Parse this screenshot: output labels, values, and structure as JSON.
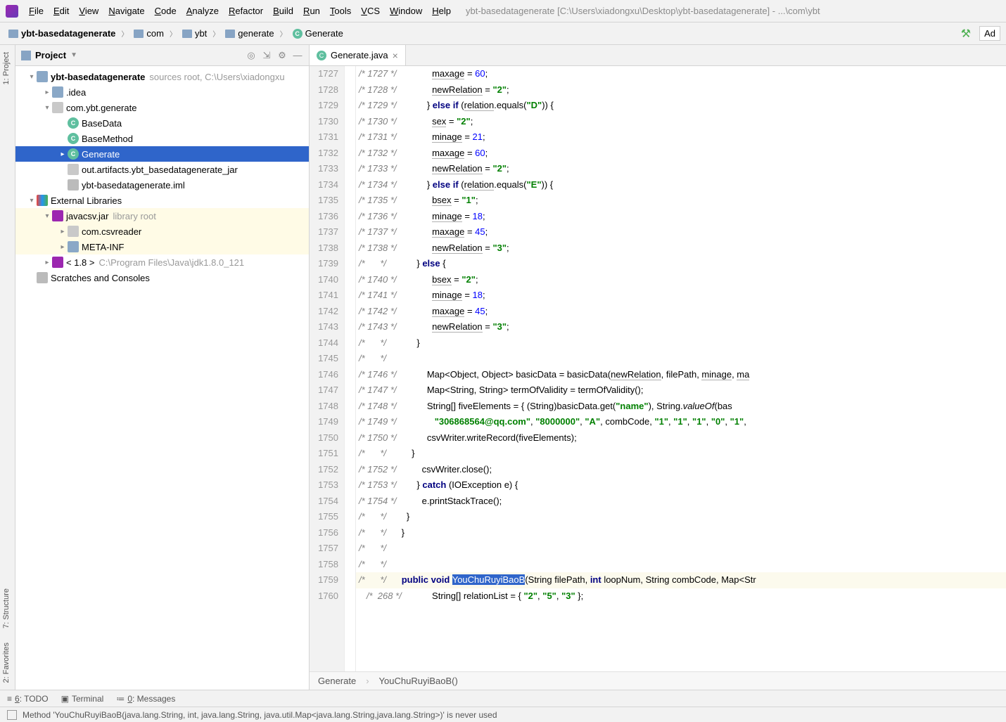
{
  "window": {
    "title_path": "ybt-basedatagenerate [C:\\Users\\xiadongxu\\Desktop\\ybt-basedatagenerate] - ...\\com\\ybt"
  },
  "menubar": {
    "items": [
      "File",
      "Edit",
      "View",
      "Navigate",
      "Code",
      "Analyze",
      "Refactor",
      "Build",
      "Run",
      "Tools",
      "VCS",
      "Window",
      "Help"
    ]
  },
  "navbar": {
    "crumbs": [
      {
        "icon": "folder",
        "label": "ybt-basedatagenerate",
        "bold": true
      },
      {
        "icon": "folder",
        "label": "com"
      },
      {
        "icon": "folder",
        "label": "ybt"
      },
      {
        "icon": "folder",
        "label": "generate"
      },
      {
        "icon": "class",
        "label": "Generate"
      }
    ],
    "right_button": "Ad"
  },
  "project": {
    "title": "Project",
    "tools": [
      "target-icon",
      "collapse-icon",
      "gear-icon",
      "hide-icon"
    ],
    "tree": [
      {
        "depth": 0,
        "chev": "down",
        "icon": "folder",
        "label": "ybt-basedatagenerate",
        "aux": "sources root,  C:\\Users\\xiadongxu"
      },
      {
        "depth": 1,
        "chev": "right",
        "icon": "folder",
        "label": ".idea"
      },
      {
        "depth": 1,
        "chev": "down",
        "icon": "pkg",
        "label": "com.ybt.generate"
      },
      {
        "depth": 2,
        "chev": "",
        "icon": "class",
        "label": "BaseData"
      },
      {
        "depth": 2,
        "chev": "",
        "icon": "class",
        "label": "BaseMethod"
      },
      {
        "depth": 2,
        "chev": "right",
        "icon": "class",
        "label": "Generate",
        "selected": true
      },
      {
        "depth": 2,
        "chev": "",
        "icon": "pkg",
        "label": "out.artifacts.ybt_basedatagenerate_jar"
      },
      {
        "depth": 2,
        "chev": "",
        "icon": "file",
        "label": "ybt-basedatagenerate.iml"
      },
      {
        "depth": 0,
        "chev": "down",
        "icon": "lib",
        "label": "External Libraries"
      },
      {
        "depth": 1,
        "chev": "down",
        "icon": "jar",
        "label": "javacsv.jar",
        "aux": "library root",
        "libbg": true
      },
      {
        "depth": 2,
        "chev": "right",
        "icon": "pkg",
        "label": "com.csvreader",
        "libbg": true
      },
      {
        "depth": 2,
        "chev": "right",
        "icon": "folder",
        "label": "META-INF",
        "libbg": true
      },
      {
        "depth": 1,
        "chev": "right",
        "icon": "jar",
        "label": "< 1.8 >",
        "aux": "C:\\Program Files\\Java\\jdk1.8.0_121"
      },
      {
        "depth": 0,
        "chev": "",
        "icon": "file",
        "label": "Scratches and Consoles"
      }
    ]
  },
  "left_strip": {
    "tabs": [
      "1: Project",
      "7: Structure",
      "2: Favorites"
    ]
  },
  "editor": {
    "tab": {
      "label": "Generate.java"
    },
    "breadcrumbs": [
      "Generate",
      "YouChuRuyiBaoB()"
    ],
    "lines": [
      {
        "n": 1727,
        "cm": "/* 1727 */",
        "parts": [
          {
            "t": "id-u",
            "v": "maxage"
          },
          {
            "t": "",
            "v": " = "
          },
          {
            "t": "num",
            "v": "60"
          },
          {
            "t": "",
            "v": ";"
          }
        ],
        "ind": 10
      },
      {
        "n": 1728,
        "cm": "/* 1728 */",
        "parts": [
          {
            "t": "id-u",
            "v": "newRelation"
          },
          {
            "t": "",
            "v": " = "
          },
          {
            "t": "str",
            "v": "\"2\""
          },
          {
            "t": "",
            "v": ";"
          }
        ],
        "ind": 10
      },
      {
        "n": 1729,
        "cm": "/* 1729 */",
        "parts": [
          {
            "t": "",
            "v": "} "
          },
          {
            "t": "kw",
            "v": "else if"
          },
          {
            "t": "",
            "v": " ("
          },
          {
            "t": "id-u",
            "v": "relation"
          },
          {
            "t": "",
            "v": ".equals("
          },
          {
            "t": "str",
            "v": "\"D\""
          },
          {
            "t": "",
            "v": ")) {"
          }
        ],
        "ind": 8
      },
      {
        "n": 1730,
        "cm": "/* 1730 */",
        "parts": [
          {
            "t": "id-u",
            "v": "sex"
          },
          {
            "t": "",
            "v": " = "
          },
          {
            "t": "str",
            "v": "\"2\""
          },
          {
            "t": "",
            "v": ";"
          }
        ],
        "ind": 10
      },
      {
        "n": 1731,
        "cm": "/* 1731 */",
        "parts": [
          {
            "t": "id-u",
            "v": "minage"
          },
          {
            "t": "",
            "v": " = "
          },
          {
            "t": "num",
            "v": "21"
          },
          {
            "t": "",
            "v": ";"
          }
        ],
        "ind": 10
      },
      {
        "n": 1732,
        "cm": "/* 1732 */",
        "parts": [
          {
            "t": "id-u",
            "v": "maxage"
          },
          {
            "t": "",
            "v": " = "
          },
          {
            "t": "num",
            "v": "60"
          },
          {
            "t": "",
            "v": ";"
          }
        ],
        "ind": 10
      },
      {
        "n": 1733,
        "cm": "/* 1733 */",
        "parts": [
          {
            "t": "id-u",
            "v": "newRelation"
          },
          {
            "t": "",
            "v": " = "
          },
          {
            "t": "str",
            "v": "\"2\""
          },
          {
            "t": "",
            "v": ";"
          }
        ],
        "ind": 10
      },
      {
        "n": 1734,
        "cm": "/* 1734 */",
        "parts": [
          {
            "t": "",
            "v": "} "
          },
          {
            "t": "kw",
            "v": "else if"
          },
          {
            "t": "",
            "v": " ("
          },
          {
            "t": "id-u",
            "v": "relation"
          },
          {
            "t": "",
            "v": ".equals("
          },
          {
            "t": "str",
            "v": "\"E\""
          },
          {
            "t": "",
            "v": ")) {"
          }
        ],
        "ind": 8
      },
      {
        "n": 1735,
        "cm": "/* 1735 */",
        "parts": [
          {
            "t": "id-u",
            "v": "bsex"
          },
          {
            "t": "",
            "v": " = "
          },
          {
            "t": "str",
            "v": "\"1\""
          },
          {
            "t": "",
            "v": ";"
          }
        ],
        "ind": 10
      },
      {
        "n": 1736,
        "cm": "/* 1736 */",
        "parts": [
          {
            "t": "id-u",
            "v": "minage"
          },
          {
            "t": "",
            "v": " = "
          },
          {
            "t": "num",
            "v": "18"
          },
          {
            "t": "",
            "v": ";"
          }
        ],
        "ind": 10
      },
      {
        "n": 1737,
        "cm": "/* 1737 */",
        "parts": [
          {
            "t": "id-u",
            "v": "maxage"
          },
          {
            "t": "",
            "v": " = "
          },
          {
            "t": "num",
            "v": "45"
          },
          {
            "t": "",
            "v": ";"
          }
        ],
        "ind": 10
      },
      {
        "n": 1738,
        "cm": "/* 1738 */",
        "parts": [
          {
            "t": "id-u",
            "v": "newRelation"
          },
          {
            "t": "",
            "v": " = "
          },
          {
            "t": "str",
            "v": "\"3\""
          },
          {
            "t": "",
            "v": ";"
          }
        ],
        "ind": 10
      },
      {
        "n": 1739,
        "cm": "/*      */",
        "parts": [
          {
            "t": "",
            "v": "} "
          },
          {
            "t": "kw",
            "v": "else"
          },
          {
            "t": "",
            "v": " {"
          }
        ],
        "ind": 8
      },
      {
        "n": 1740,
        "cm": "/* 1740 */",
        "parts": [
          {
            "t": "id-u",
            "v": "bsex"
          },
          {
            "t": "",
            "v": " = "
          },
          {
            "t": "str",
            "v": "\"2\""
          },
          {
            "t": "",
            "v": ";"
          }
        ],
        "ind": 10
      },
      {
        "n": 1741,
        "cm": "/* 1741 */",
        "parts": [
          {
            "t": "id-u",
            "v": "minage"
          },
          {
            "t": "",
            "v": " = "
          },
          {
            "t": "num",
            "v": "18"
          },
          {
            "t": "",
            "v": ";"
          }
        ],
        "ind": 10
      },
      {
        "n": 1742,
        "cm": "/* 1742 */",
        "parts": [
          {
            "t": "id-u",
            "v": "maxage"
          },
          {
            "t": "",
            "v": " = "
          },
          {
            "t": "num",
            "v": "45"
          },
          {
            "t": "",
            "v": ";"
          }
        ],
        "ind": 10
      },
      {
        "n": 1743,
        "cm": "/* 1743 */",
        "parts": [
          {
            "t": "id-u",
            "v": "newRelation"
          },
          {
            "t": "",
            "v": " = "
          },
          {
            "t": "str",
            "v": "\"3\""
          },
          {
            "t": "",
            "v": ";"
          }
        ],
        "ind": 10
      },
      {
        "n": 1744,
        "cm": "/*      */",
        "parts": [
          {
            "t": "",
            "v": "}"
          }
        ],
        "ind": 8
      },
      {
        "n": 1745,
        "cm": "/*      */",
        "parts": [],
        "ind": 0
      },
      {
        "n": 1746,
        "cm": "/* 1746 */",
        "parts": [
          {
            "t": "",
            "v": "Map<Object, Object> basicData = basicData("
          },
          {
            "t": "id-u",
            "v": "newRelation"
          },
          {
            "t": "",
            "v": ", filePath, "
          },
          {
            "t": "id-u",
            "v": "minage"
          },
          {
            "t": "",
            "v": ", "
          },
          {
            "t": "id-u",
            "v": "ma"
          }
        ],
        "ind": 8
      },
      {
        "n": 1747,
        "cm": "/* 1747 */",
        "parts": [
          {
            "t": "",
            "v": "Map<String, String> termOfValidity = termOfValidity();"
          }
        ],
        "ind": 8
      },
      {
        "n": 1748,
        "cm": "/* 1748 */",
        "parts": [
          {
            "t": "",
            "v": "String[] fiveElements = { (String)basicData.get("
          },
          {
            "t": "str",
            "v": "\"name\""
          },
          {
            "t": "",
            "v": "), String."
          },
          {
            "t": "fn-it",
            "v": "valueOf"
          },
          {
            "t": "",
            "v": "(bas"
          }
        ],
        "ind": 8
      },
      {
        "n": 1749,
        "cm": "/* 1749 */",
        "parts": [
          {
            "t": "str",
            "v": "\"306868564@qq.com\""
          },
          {
            "t": "",
            "v": ", "
          },
          {
            "t": "str",
            "v": "\"8000000\""
          },
          {
            "t": "",
            "v": ", "
          },
          {
            "t": "str",
            "v": "\"A\""
          },
          {
            "t": "",
            "v": ", combCode, "
          },
          {
            "t": "str",
            "v": "\"1\""
          },
          {
            "t": "",
            "v": ", "
          },
          {
            "t": "str",
            "v": "\"1\""
          },
          {
            "t": "",
            "v": ", "
          },
          {
            "t": "str",
            "v": "\"1\""
          },
          {
            "t": "",
            "v": ", "
          },
          {
            "t": "str",
            "v": "\"0\""
          },
          {
            "t": "",
            "v": ", "
          },
          {
            "t": "str",
            "v": "\"1\""
          },
          {
            "t": "",
            "v": ", "
          }
        ],
        "ind": 11
      },
      {
        "n": 1750,
        "cm": "/* 1750 */",
        "parts": [
          {
            "t": "",
            "v": "csvWriter.writeRecord(fiveElements);"
          }
        ],
        "ind": 8
      },
      {
        "n": 1751,
        "cm": "/*      */",
        "parts": [
          {
            "t": "",
            "v": "}"
          }
        ],
        "ind": 6
      },
      {
        "n": 1752,
        "cm": "/* 1752 */",
        "parts": [
          {
            "t": "",
            "v": "csvWriter.close();"
          }
        ],
        "ind": 6
      },
      {
        "n": 1753,
        "cm": "/* 1753 */",
        "parts": [
          {
            "t": "",
            "v": "} "
          },
          {
            "t": "kw",
            "v": "catch"
          },
          {
            "t": "",
            "v": " (IOException e) {"
          }
        ],
        "ind": 4
      },
      {
        "n": 1754,
        "cm": "/* 1754 */",
        "parts": [
          {
            "t": "",
            "v": "e.printStackTrace();"
          }
        ],
        "ind": 6
      },
      {
        "n": 1755,
        "cm": "/*      */",
        "parts": [
          {
            "t": "",
            "v": "}"
          }
        ],
        "ind": 4
      },
      {
        "n": 1756,
        "cm": "/*      */",
        "parts": [
          {
            "t": "",
            "v": "}"
          }
        ],
        "ind": 2
      },
      {
        "n": 1757,
        "cm": "/*      */",
        "parts": [],
        "ind": 0
      },
      {
        "n": 1758,
        "cm": "/*      */",
        "parts": [],
        "ind": 0
      },
      {
        "n": 1759,
        "cm": "/*      */",
        "caret": true,
        "parts": [
          {
            "t": "kw",
            "v": "public"
          },
          {
            "t": "",
            "v": " "
          },
          {
            "t": "kw",
            "v": "void"
          },
          {
            "t": "",
            "v": " "
          },
          {
            "t": "sel",
            "v": "YouChuRuyiBaoB"
          },
          {
            "t": "",
            "v": "(String filePath, "
          },
          {
            "t": "kw",
            "v": "int"
          },
          {
            "t": "",
            "v": " loopNum, String combCode, Map<Str"
          }
        ],
        "ind": 2
      },
      {
        "n": 1760,
        "cm": "   /*  268 */",
        "parts": [
          {
            "t": "",
            "v": "String[] relationList = { "
          },
          {
            "t": "str",
            "v": "\"2\""
          },
          {
            "t": "",
            "v": ", "
          },
          {
            "t": "str",
            "v": "\"5\""
          },
          {
            "t": "",
            "v": ", "
          },
          {
            "t": "str",
            "v": "\"3\""
          },
          {
            "t": "",
            "v": " };"
          }
        ],
        "ind": 8
      }
    ]
  },
  "bottom_tools": {
    "items": [
      "6: TODO",
      "Terminal",
      "0: Messages"
    ]
  },
  "status": {
    "message": "Method 'YouChuRuyiBaoB(java.lang.String, int, java.lang.String, java.util.Map<java.lang.String,java.lang.String>)' is never used"
  }
}
